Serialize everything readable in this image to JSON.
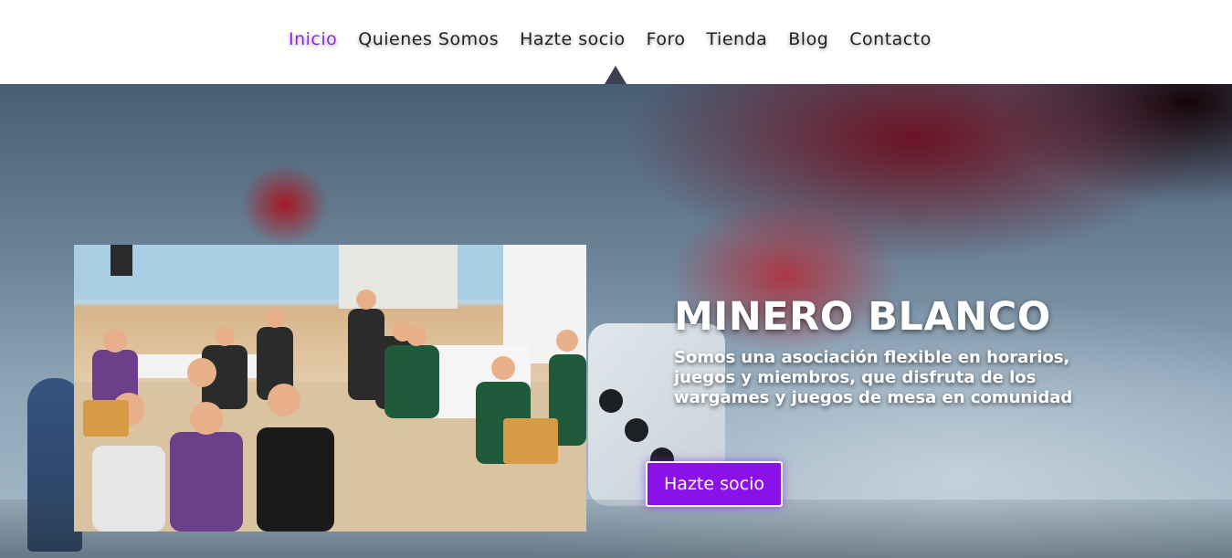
{
  "nav": {
    "items": [
      {
        "label": "Inicio",
        "active": true
      },
      {
        "label": "Quienes Somos",
        "active": false
      },
      {
        "label": "Hazte socio",
        "active": false
      },
      {
        "label": "Foro",
        "active": false
      },
      {
        "label": "Tienda",
        "active": false
      },
      {
        "label": "Blog",
        "active": false
      },
      {
        "label": "Contacto",
        "active": false
      }
    ],
    "active_color": "#8a2be2",
    "text_color": "#222222"
  },
  "hero": {
    "title": "MINERO BLANCO",
    "description": "Somos una asociación flexible en horarios, juegos y miembros, que disfruta de los wargames y juegos de mesa en comunidad",
    "cta_label": "Hazte socio",
    "cta_color": "#8a12e6",
    "photo_alt": "group-photo"
  }
}
